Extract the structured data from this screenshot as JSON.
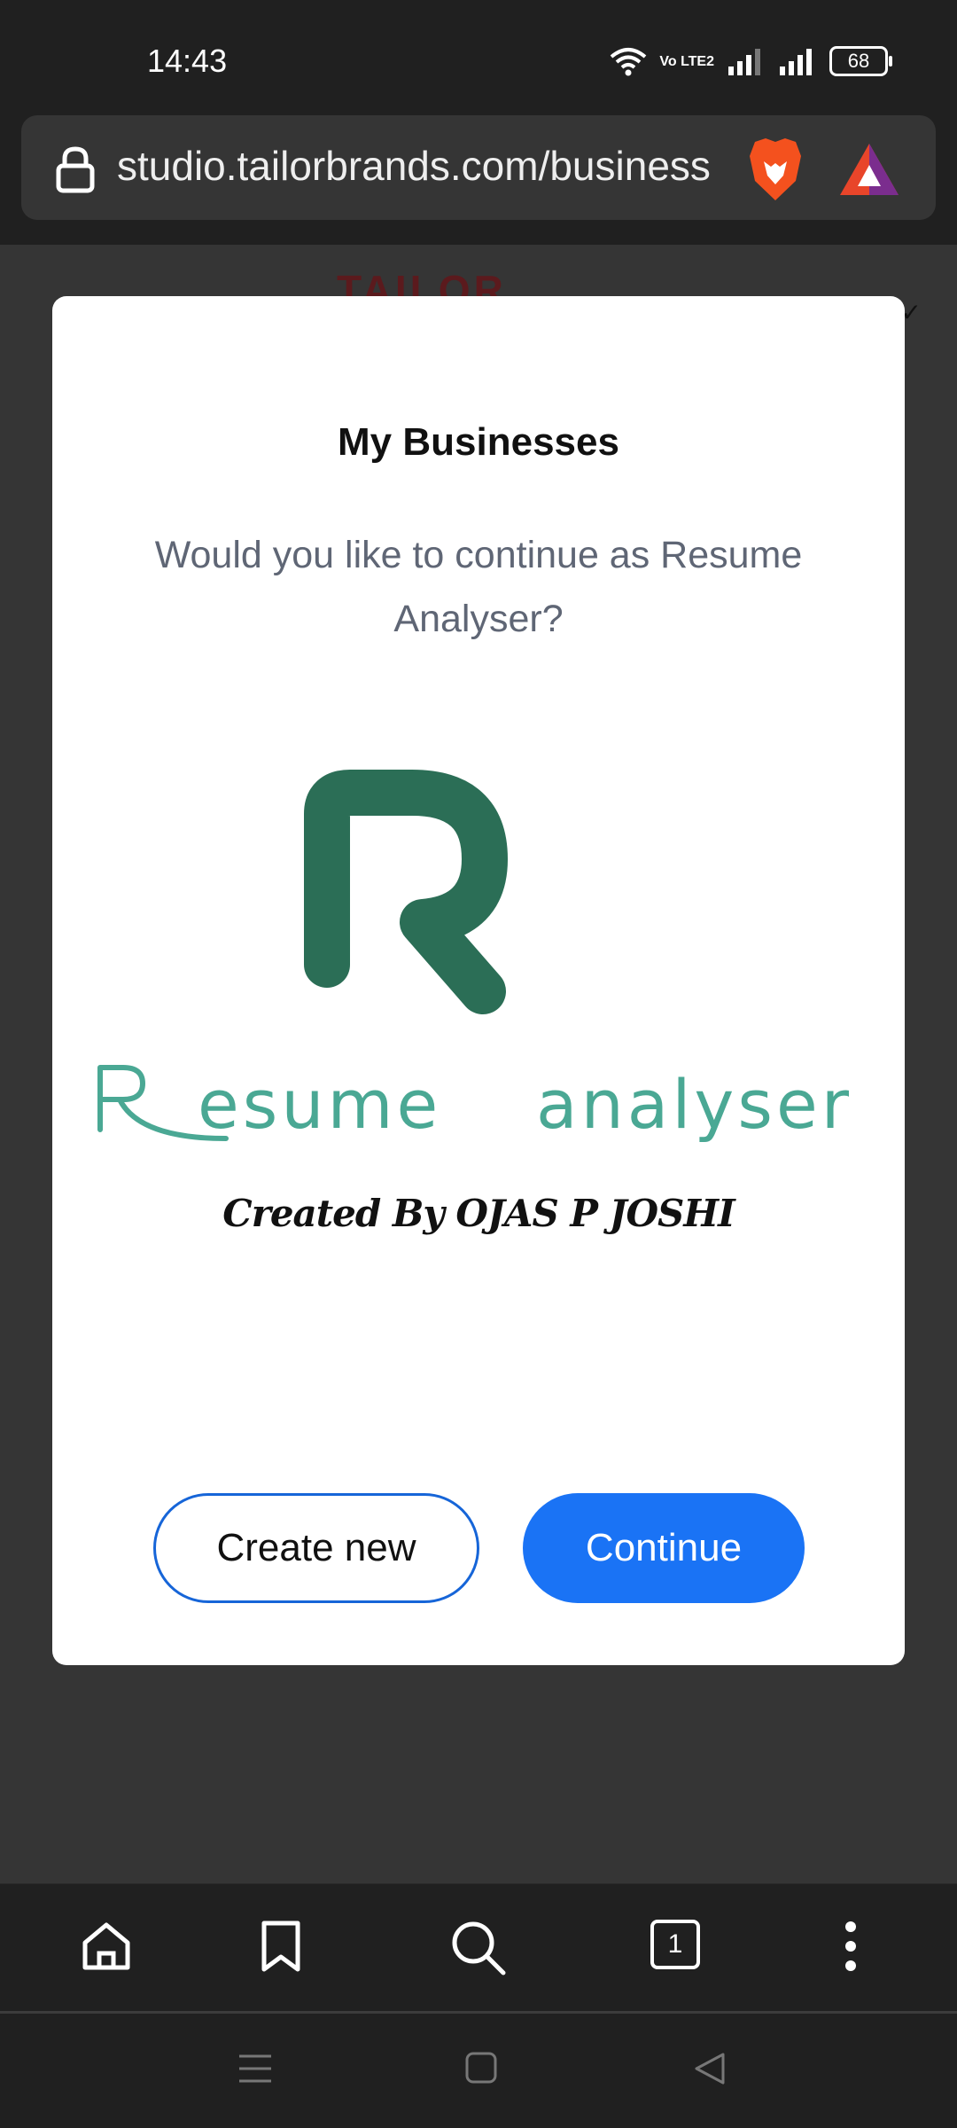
{
  "status_bar": {
    "time": "14:43",
    "battery": "68",
    "network_label": "Vo LTE2"
  },
  "browser": {
    "url": "studio.tailorbrands.com/business",
    "tab_count": "1"
  },
  "background_page": {
    "brand_peek": "TAILOR"
  },
  "modal": {
    "title": "My Businesses",
    "question": "Would you like to continue as Resume Analyser?",
    "logo": {
      "wordmark": "R esume  analyser",
      "signature": "Created By OJAS P JOSHI",
      "color": "#2b6e56"
    },
    "create_label": "Create new",
    "continue_label": "Continue"
  },
  "colors": {
    "primary": "#1a73f5",
    "outline": "#1665d8",
    "logo_green": "#2b6e56",
    "logo_teal": "#4aa894"
  }
}
